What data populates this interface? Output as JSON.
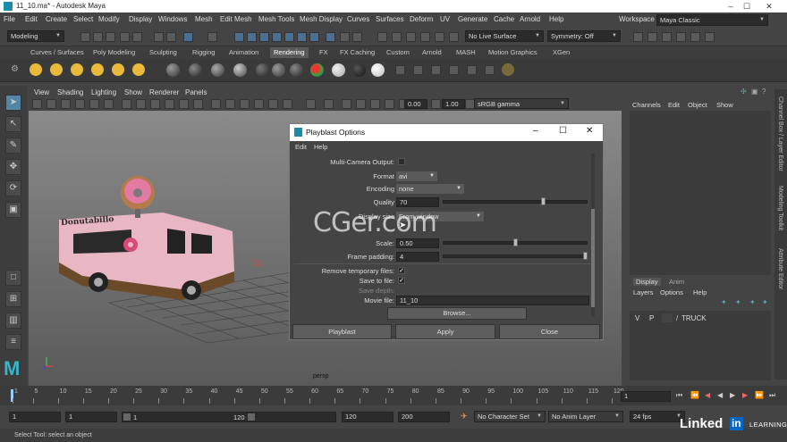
{
  "window": {
    "title": "11_10.ma* - Autodesk Maya",
    "minimize_glyph": "–",
    "maximize_glyph": "☐",
    "close_glyph": "✕"
  },
  "menubar": {
    "items": [
      "File",
      "Edit",
      "Create",
      "Select",
      "Modify",
      "Display",
      "Windows",
      "Mesh",
      "Edit Mesh",
      "Mesh Tools",
      "Mesh Display",
      "Curves",
      "Surfaces",
      "Deform",
      "UV",
      "Generate",
      "Cache",
      "Arnold",
      "Help"
    ],
    "workspace_label": "Workspace :",
    "workspace_value": "Maya Classic"
  },
  "statusline": {
    "mode": "Modeling",
    "live_surface": "No Live Surface",
    "symmetry": "Symmetry: Off"
  },
  "shelf": {
    "tabs": [
      "Curves / Surfaces",
      "Poly Modeling",
      "Sculpting",
      "Rigging",
      "Animation",
      "Rendering",
      "FX",
      "FX Caching",
      "Custom",
      "Arnold",
      "MASH",
      "Motion Graphics",
      "XGen"
    ],
    "active_tab": "Rendering"
  },
  "viewport": {
    "menus": [
      "View",
      "Shading",
      "Lighting",
      "Show",
      "Renderer",
      "Panels"
    ],
    "exposure": "0.00",
    "gamma": "1.00",
    "colorspace": "sRGB gamma",
    "camera_label": "persp",
    "truck_sign": "Donutabillo"
  },
  "channelbox": {
    "menus": [
      "Channels",
      "Edit",
      "Object",
      "Show"
    ]
  },
  "layers": {
    "tabs": [
      "Display",
      "Anim"
    ],
    "menus": [
      "Layers",
      "Options",
      "Help"
    ],
    "row": {
      "v": "V",
      "p": "P",
      "name": "TRUCK"
    }
  },
  "sidetabs": [
    "Channel Box / Layer Editor",
    "Modeling Toolkit",
    "Attribute Editor"
  ],
  "dialog": {
    "title": "Playblast Options",
    "menus": [
      "Edit",
      "Help"
    ],
    "multi_camera_label": "Multi-Camera Output:",
    "format_label": "Format",
    "format_value": "avi",
    "encoding_label": "Encoding",
    "encoding_value": "none",
    "quality_label": "Quality",
    "quality_value": "70",
    "display_size_label": "Display size",
    "display_size_value": "From window",
    "scale_label": "Scale:",
    "scale_value": "0.50",
    "frame_padding_label": "Frame padding:",
    "frame_padding_value": "4",
    "remove_temp_label": "Remove temporary files:",
    "save_to_file_label": "Save to file:",
    "save_depth_label": "Save depth:",
    "movie_file_label": "Movie file:",
    "movie_file_value": "11_10",
    "browse_label": "Browse...",
    "buttons": {
      "playblast": "Playblast",
      "apply": "Apply",
      "close": "Close"
    },
    "watermark": "CGer.com",
    "checks": {
      "remove_temp": "✓",
      "save_to_file": "✓"
    },
    "quality_fraction": 0.7,
    "scale_fraction": 0.5,
    "frame_padding_fraction": 1.0
  },
  "timeline": {
    "ticks": [
      "1",
      "5",
      "10",
      "15",
      "20",
      "25",
      "30",
      "35",
      "40",
      "45",
      "50",
      "55",
      "60",
      "65",
      "70",
      "75",
      "80",
      "85",
      "90",
      "95",
      "100",
      "105",
      "110",
      "115",
      "120"
    ],
    "current_frame": "1"
  },
  "range": {
    "start": "1",
    "start2": "1",
    "slider_start": "1",
    "slider_end": "120",
    "end": "120",
    "end2": "200",
    "character_set": "No Character Set",
    "anim_layer": "No Anim Layer",
    "fps": "24 fps"
  },
  "helpline": {
    "text": "Select Tool: select an object"
  },
  "branding": {
    "linkedin": "Linked",
    "in": "in",
    "learning": "LEARNING"
  }
}
